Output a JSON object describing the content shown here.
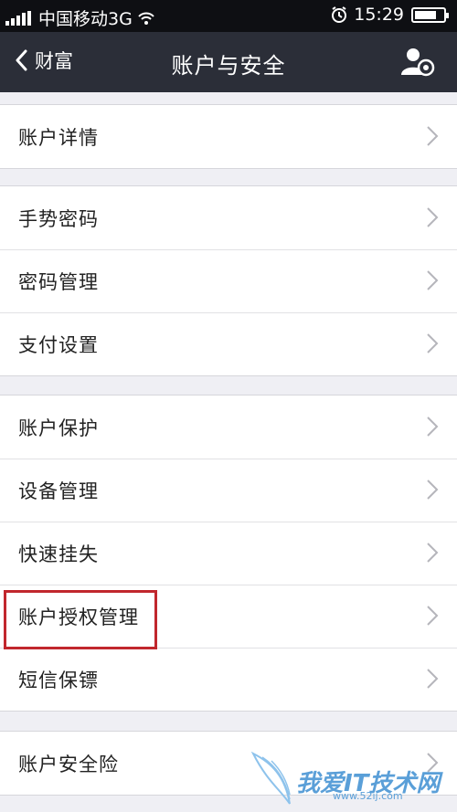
{
  "status_bar": {
    "carrier": "中国移动3G",
    "time": "15:29",
    "battery_percent": 80
  },
  "nav": {
    "back_label": "财富",
    "title": "账户与安全"
  },
  "groups": [
    {
      "items": [
        "账户详情"
      ]
    },
    {
      "items": [
        "手势密码",
        "密码管理",
        "支付设置"
      ]
    },
    {
      "items": [
        "账户保护",
        "设备管理",
        "快速挂失",
        "账户授权管理",
        "短信保镖"
      ]
    },
    {
      "items": [
        "账户安全险"
      ]
    }
  ],
  "highlighted_item": "账户授权管理",
  "watermark": {
    "text": "我爱IT技术网",
    "url": "www.52ij.com"
  },
  "colors": {
    "navbar": "#2b2e38",
    "background": "#efeff4",
    "highlight_border": "#c1272d",
    "watermark": "#5a9fd8"
  },
  "icons": [
    "signal-icon",
    "wifi-icon",
    "alarm-icon",
    "battery-icon",
    "back-chevron-icon",
    "user-settings-icon",
    "chevron-right-icon"
  ]
}
